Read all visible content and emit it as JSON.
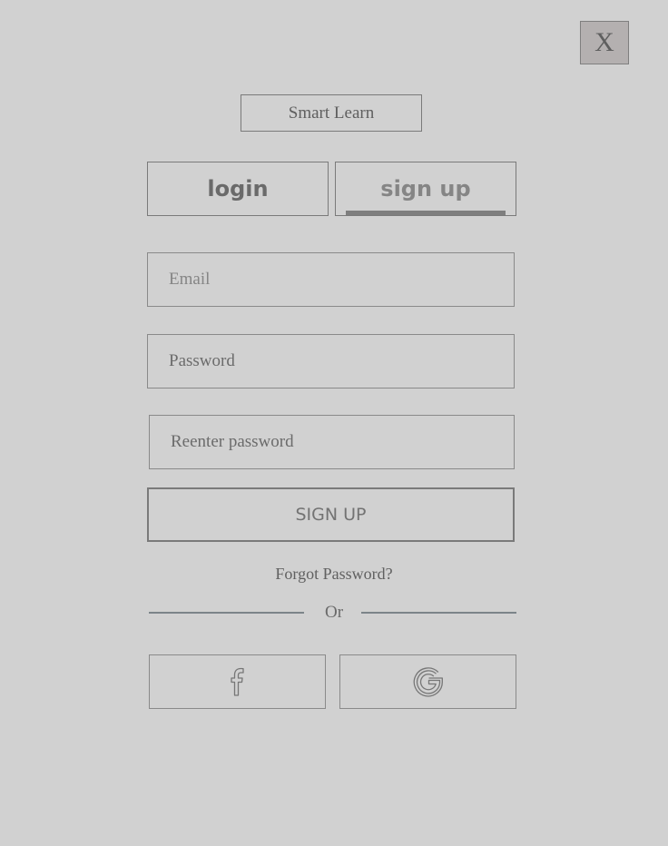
{
  "close_button": {
    "label": "X"
  },
  "app": {
    "title": "Smart Learn"
  },
  "tabs": [
    {
      "label": "login",
      "active": false
    },
    {
      "label": "sign up",
      "active": true
    }
  ],
  "form": {
    "email_placeholder": "Email",
    "password_placeholder": "Password",
    "reenter_placeholder": "Reenter password",
    "submit_label": "SIGN UP",
    "forgot_label": "Forgot Password?"
  },
  "divider": {
    "label": "Or"
  },
  "social": [
    {
      "icon": "facebook-icon"
    },
    {
      "icon": "google-icon"
    }
  ],
  "colors": {
    "background": "#d1d1d1",
    "close_button_bg": "#b4b0b0",
    "text": "#5f5f5f",
    "divider": "#7c8489"
  }
}
